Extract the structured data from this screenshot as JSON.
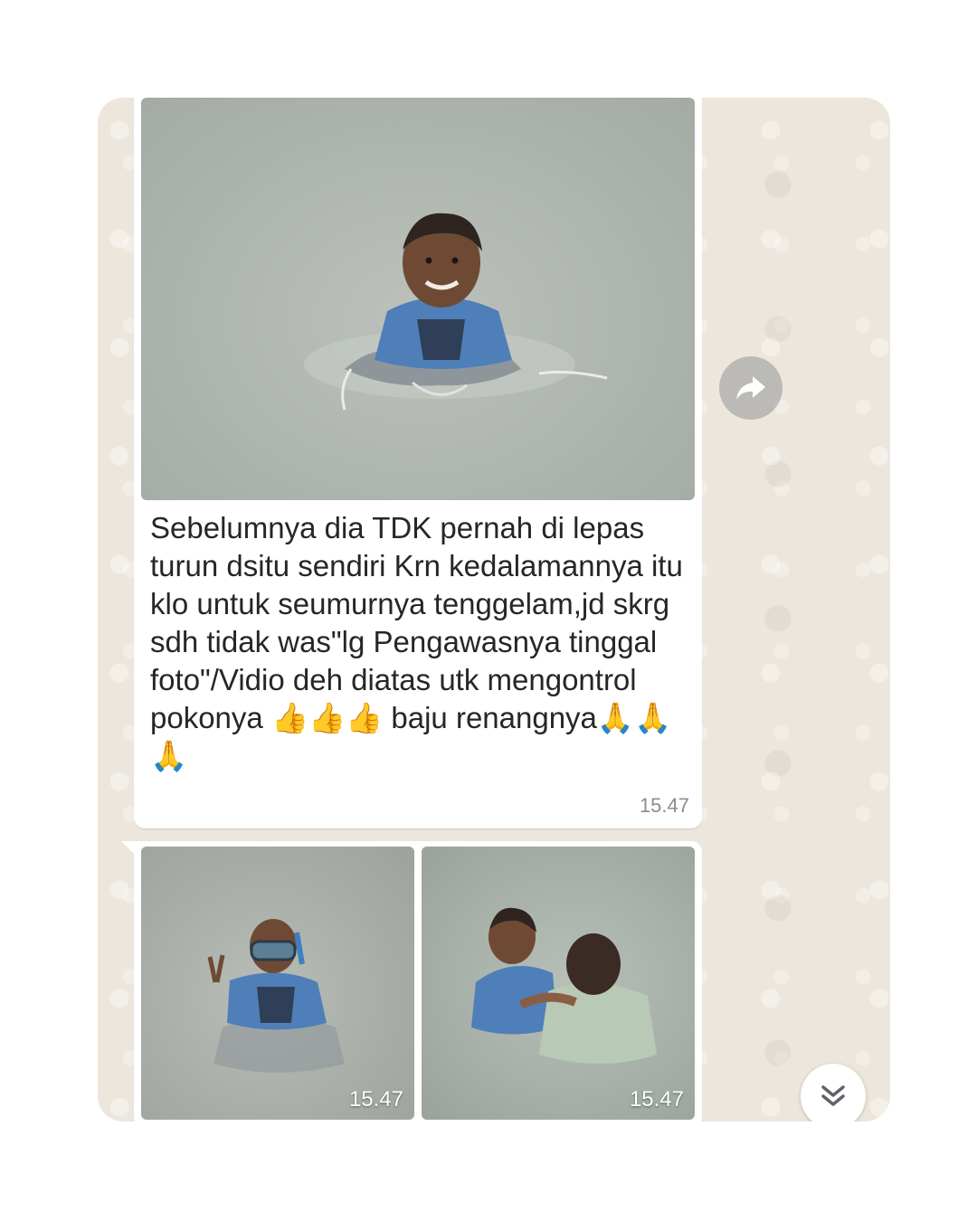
{
  "messages": [
    {
      "type": "image-with-caption",
      "caption": "Sebelumnya dia TDK pernah di lepas turun dsitu sendiri Krn kedalamannya itu klo untuk seumurnya tenggelam,jd skrg sdh tidak was\"lg Pengawasnya tinggal foto\"/Vidio deh diatas utk mengontrol pokonya",
      "emoji_thumbs": "👍👍👍",
      "caption_tail": "baju renangnya",
      "emoji_pray": "🙏🙏🙏",
      "time": "15.47"
    },
    {
      "type": "image-group",
      "images": [
        {
          "time": "15.47"
        },
        {
          "time": "15.47"
        }
      ]
    }
  ],
  "icons": {
    "forward": "forward-arrow-icon",
    "scroll_down": "double-chevron-down-icon"
  },
  "colors": {
    "chat_background": "#ece6dd",
    "bubble": "#ffffff",
    "timestamp": "#8c8c8c",
    "icon_gray": "#5f6368"
  }
}
